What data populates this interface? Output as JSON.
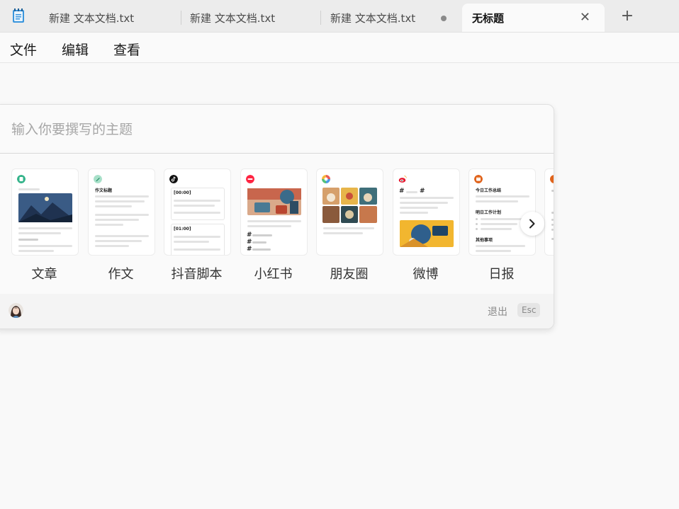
{
  "tabs": [
    {
      "label": "新建 文本文档.txt",
      "state": "normal"
    },
    {
      "label": "新建 文本文档.txt",
      "state": "normal"
    },
    {
      "label": "新建 文本文档.txt",
      "state": "unsaved"
    },
    {
      "label": "无标题",
      "state": "active"
    }
  ],
  "tab_close_glyph": "✕",
  "new_tab_glyph": "+",
  "menu": [
    "文件",
    "编辑",
    "查看"
  ],
  "panel": {
    "placeholder": "输入你要撰写的主题",
    "templates": [
      {
        "label": "文章",
        "icon": "document-icon"
      },
      {
        "label": "作文",
        "icon": "pen-icon"
      },
      {
        "label": "抖音脚本",
        "icon": "douyin-icon"
      },
      {
        "label": "小红书",
        "icon": "xiaohongshu-icon"
      },
      {
        "label": "朋友圈",
        "icon": "moments-icon"
      },
      {
        "label": "微博",
        "icon": "weibo-icon"
      },
      {
        "label": "日报",
        "icon": "daily-report-icon"
      }
    ],
    "card_text": {
      "essay_title": "作文标题",
      "ts1": "[00:00]",
      "ts2": "[01:00]",
      "report_today": "今日工作总结",
      "report_tomorrow": "明日工作计划",
      "report_other": "其他事项"
    },
    "exit_label": "退出",
    "esc_key": "Esc"
  },
  "colors": {
    "accent_green": "#34b38a",
    "douyin": "#111111",
    "xiaohongshu": "#ff2442",
    "weibo": "#e6162d",
    "report": "#e0631b"
  }
}
